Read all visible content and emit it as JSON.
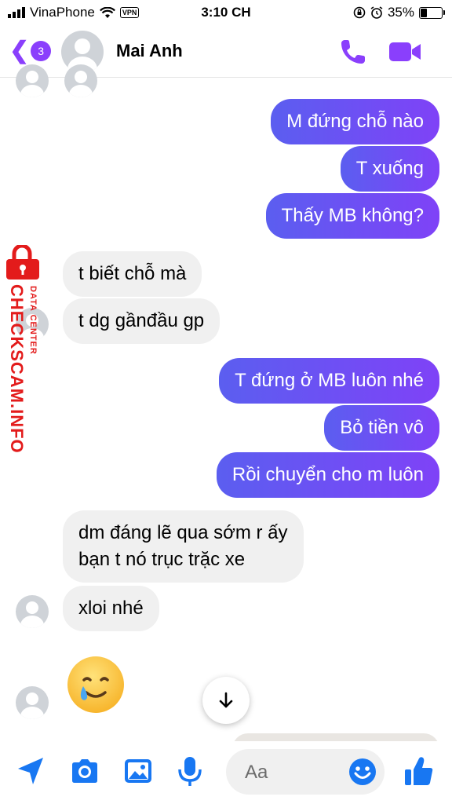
{
  "status_bar": {
    "carrier": "VinaPhone",
    "vpn": "VPN",
    "time": "3:10 CH",
    "battery_percent": "35%",
    "battery_level": 0.35
  },
  "header": {
    "unread_count": "3",
    "contact_name": "Mai Anh",
    "icons": {
      "back": "chevron-left-icon",
      "call": "phone-icon",
      "video": "video-camera-icon"
    }
  },
  "watermark": {
    "main_text": "CHECKSCAM.INFO",
    "sub_text": "DATA CENTER"
  },
  "messages": [
    {
      "direction": "outgoing",
      "text": "M đứng chỗ nào"
    },
    {
      "direction": "outgoing",
      "text": "T xuống"
    },
    {
      "direction": "outgoing",
      "text": "Thấy MB không?"
    },
    {
      "direction": "incoming",
      "text": "t biết chỗ mà"
    },
    {
      "direction": "incoming",
      "text": "t dg gầnđầu gp"
    },
    {
      "direction": "outgoing",
      "text": "T đứng ở MB luôn nhé"
    },
    {
      "direction": "outgoing",
      "text": "Bỏ tiền vô"
    },
    {
      "direction": "outgoing",
      "text": "Rồi chuyển cho m luôn"
    },
    {
      "direction": "incoming",
      "text_line1": "dm đáng lẽ qua sớm r ấy",
      "text_line2": "bạn t nó trục trặc xe"
    },
    {
      "direction": "incoming",
      "text": "xloi nhé"
    },
    {
      "direction": "incoming",
      "emoji": "smiling-face-with-tear"
    }
  ],
  "composer": {
    "placeholder": "Aa",
    "icons": [
      "send-location-icon",
      "camera-icon",
      "photo-icon",
      "microphone-icon",
      "emoji-icon",
      "thumbs-up-icon"
    ]
  },
  "colors": {
    "accent": "#8a3ffc",
    "outgoing_gradient_start": "#5b5ef0",
    "outgoing_gradient_end": "#7f42f7",
    "incoming_bubble": "#f0f0f0",
    "composer_icon": "#1877f2",
    "watermark": "#e31b1b"
  }
}
